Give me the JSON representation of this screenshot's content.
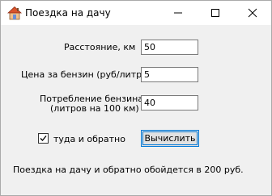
{
  "window": {
    "title": "Поездка на дачу",
    "icon": "house-icon"
  },
  "form": {
    "distance_label": "Расстояние, км",
    "distance_value": "50",
    "price_label": "Цена за бензин (руб/литр)",
    "price_value": "5",
    "consumption_label_line1": "Потребление бензина",
    "consumption_label_line2": "(литров на 100 км)",
    "consumption_value": "40",
    "roundtrip_label": "туда и обратно",
    "roundtrip_checked": true,
    "calculate_label": "Вычислить",
    "result_text": "Поездка на дачу и обратно обойдется в 200 руб."
  },
  "colors": {
    "accent": "#0078d7",
    "window_bg": "#f0f0f0",
    "titlebar_bg": "#ffffff"
  }
}
